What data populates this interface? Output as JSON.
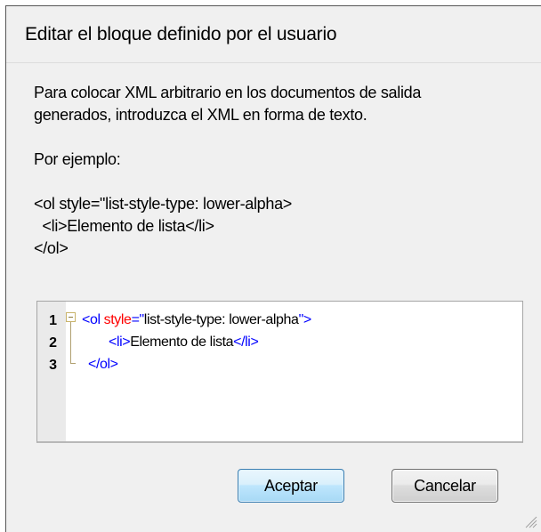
{
  "dialog": {
    "title": "Editar el bloque definido por el usuario",
    "instructions_line1": "Para colocar XML arbitrario en los documentos de salida",
    "instructions_line2": "generados, introduzca el XML en forma de texto.",
    "example_label": "Por ejemplo:",
    "example_code": [
      "<ol style=\"list-style-type: lower-alpha>",
      "  <li>Elemento de lista</li>",
      "</ol>"
    ]
  },
  "editor": {
    "line_numbers": [
      "1",
      "2",
      "3"
    ],
    "line1": {
      "open": "<ol ",
      "attr": "style",
      "eq": "=\"",
      "value": "list-style-type: lower-alpha",
      "close": "\">"
    },
    "line2": {
      "open": "<li>",
      "text": "Elemento de lista",
      "close": "</li>"
    },
    "line3": {
      "close": "</ol>"
    }
  },
  "buttons": {
    "ok_label": "Aceptar",
    "cancel_label": "Cancelar"
  },
  "colors": {
    "tag": "#0000ff",
    "attribute": "#ff0000",
    "dialog_bg": "#f0f0f0"
  }
}
